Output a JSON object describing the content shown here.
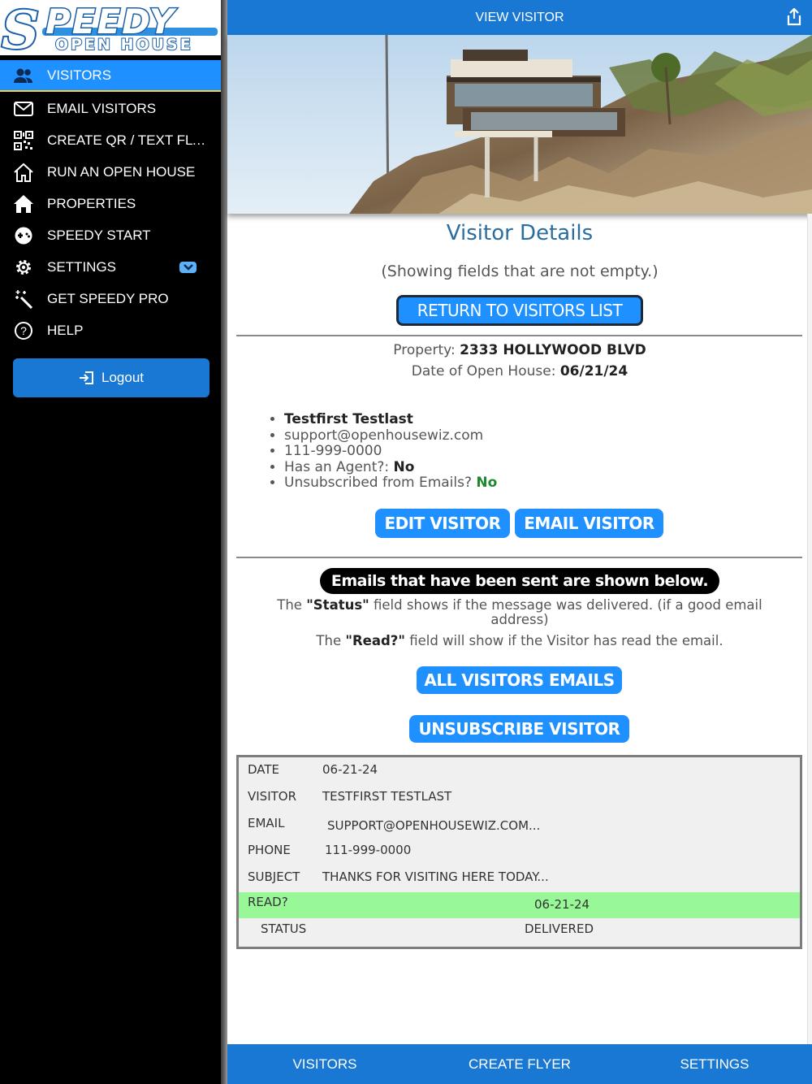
{
  "logo": {
    "mark": "S",
    "brand": "PEEDY",
    "tagline": "OPEN HOUSE"
  },
  "sidebar": {
    "items": [
      {
        "label": "VISITORS",
        "icon": "people-icon",
        "active": true
      },
      {
        "label": "EMAIL VISITORS",
        "icon": "envelope-icon"
      },
      {
        "label": "CREATE QR / TEXT FLY...",
        "icon": "qr-code-icon"
      },
      {
        "label": "RUN AN OPEN HOUSE",
        "icon": "house-outline-icon"
      },
      {
        "label": "PROPERTIES",
        "icon": "house-filled-icon"
      },
      {
        "label": "SPEEDY START",
        "icon": "gamepad-icon"
      },
      {
        "label": "SETTINGS",
        "icon": "gear-icon"
      },
      {
        "label": "GET SPEEDY PRO",
        "icon": "magic-wand-icon"
      },
      {
        "label": "HELP",
        "icon": "help-circle-icon"
      }
    ],
    "logout_label": "Logout"
  },
  "header": {
    "title": "VIEW VISITOR"
  },
  "details": {
    "title": "Visitor Details",
    "subtitle": "(Showing fields that are not empty.)",
    "return_button": "RETURN TO VISITORS LIST",
    "property_label": "Property:",
    "property_value": "2333 HOLLYWOOD BLVD",
    "date_label": "Date of Open House:",
    "date_value": "06/21/24"
  },
  "visitor": {
    "name": "Testfirst Testlast",
    "email": "support@openhousewiz.com",
    "phone": "111-999-0000",
    "agent_label": "Has an Agent?:",
    "agent_value": "No",
    "unsub_label": "Unsubscribed from Emails?",
    "unsub_value": "No"
  },
  "actions": {
    "edit": "EDIT VISITOR",
    "email": "EMAIL VISITOR",
    "all_emails": "ALL VISITORS EMAILS",
    "unsubscribe": "UNSUBSCRIBE VISITOR"
  },
  "emails_info": {
    "banner": "Emails that have been sent are shown below.",
    "status_pre": "The ",
    "status_key": "\"Status\"",
    "status_post": " field shows if the message was delivered. (if a good email address)",
    "read_pre": "The ",
    "read_key": "\"Read?\"",
    "read_post": " field will show if the Visitor has read the email."
  },
  "email_record": {
    "date_label": "DATE",
    "date": "06-21-24",
    "visitor_label": "VISITOR",
    "visitor": "TESTFIRST TESTLAST",
    "email_label": "EMAIL",
    "email": "SUPPORT@OPENHOUSEWIZ.COM...",
    "phone_label": "PHONE",
    "phone": "111-999-0000",
    "subject_label": "SUBJECT",
    "subject": "THANKS FOR VISITING HERE TODAY...",
    "read_label": "READ?",
    "read": "06-21-24",
    "status_label": "STATUS",
    "status": "DELIVERED"
  },
  "tabbar": {
    "tabs": [
      "VISITORS",
      "CREATE FLYER",
      "SETTINGS"
    ]
  },
  "colors": {
    "primary": "#1878d3",
    "button": "#1e90ff",
    "accent_yellow": "#f2d23c",
    "read_green": "#98f898",
    "title_blue": "#2a6d9e"
  }
}
